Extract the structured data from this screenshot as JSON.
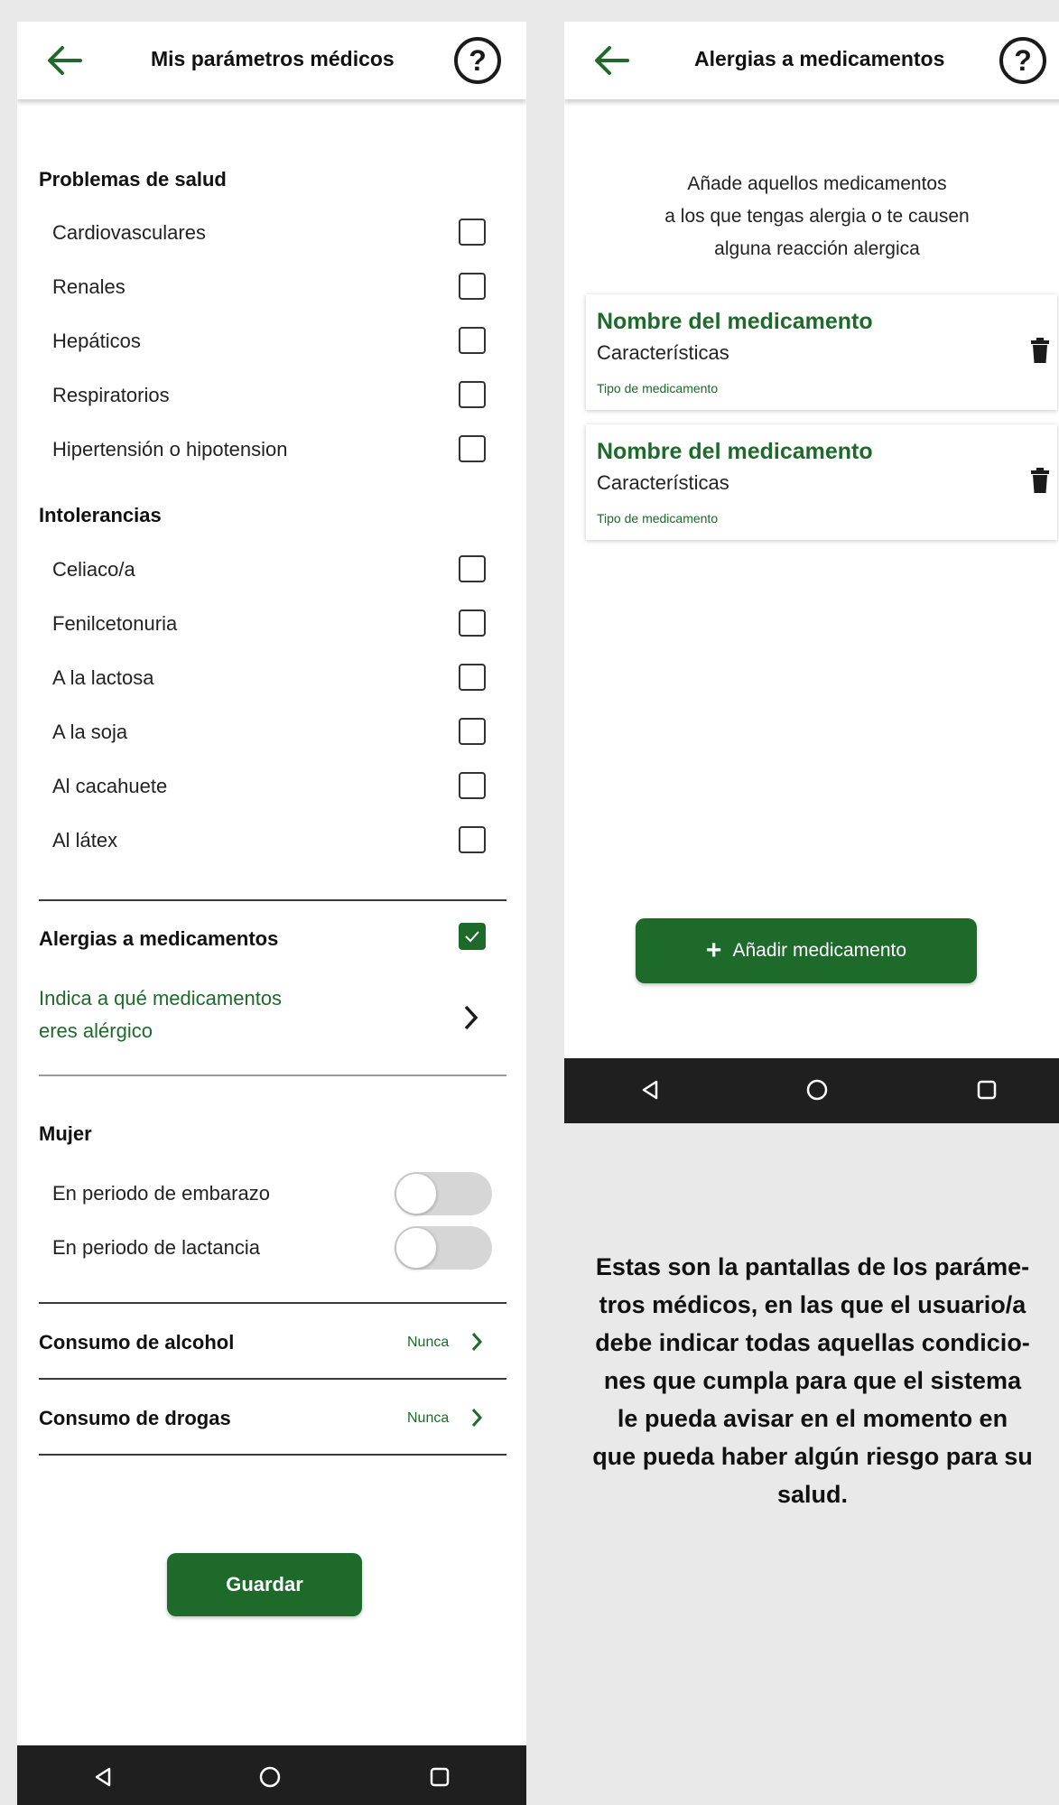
{
  "left_screen": {
    "title": "Mis parámetros médicos",
    "help_symbol": "?",
    "problems": {
      "heading": "Problemas de salud",
      "items": [
        "Cardiovasculares",
        "Renales",
        "Hepáticos",
        "Respiratorios",
        "Hipertensión o hipotension"
      ]
    },
    "intolerances": {
      "heading": "Intolerancias",
      "items": [
        "Celiaco/a",
        "Fenilcetonuria",
        "A la lactosa",
        "A la soja",
        "Al cacahuete",
        "Al látex"
      ]
    },
    "allergies": {
      "heading": "Alergias a medicamentos",
      "checked": true,
      "link_line1": "Indica a qué medicamentos",
      "link_line2": "eres alérgico"
    },
    "woman": {
      "heading": "Mujer",
      "pregnancy": {
        "label": "En periodo de embarazo",
        "on": false
      },
      "lactation": {
        "label": "En periodo de lactancia",
        "on": false
      }
    },
    "alcohol": {
      "label": "Consumo de alcohol",
      "value": "Nunca"
    },
    "drugs": {
      "label": "Consumo de drogas",
      "value": "Nunca"
    },
    "save_label": "Guardar"
  },
  "right_screen": {
    "title": "Alergias a medicamentos",
    "help_symbol": "?",
    "intro_lines": [
      "Añade aquellos medicamentos",
      "a los que tengas alergia o te causen",
      "alguna reacción alergica"
    ],
    "cards": [
      {
        "name": "Nombre del medicamento",
        "characteristics": "Características",
        "type": "Tipo de medicamento"
      },
      {
        "name": "Nombre del medicamento",
        "characteristics": "Características",
        "type": "Tipo de medicamento"
      }
    ],
    "add_button": {
      "icon": "+",
      "label": "Añadir medicamento"
    }
  },
  "caption_lines": [
    "Estas son la pantallas de los paráme-",
    "tros médicos, en las que el usuario/a",
    "debe indicar todas aquellas condicio-",
    "nes que cumpla para que el sistema",
    "le pueda avisar en el momento en",
    "que pueda haber algún riesgo para su",
    "salud."
  ],
  "colors": {
    "accent_green": "#1d6a2b",
    "navbar": "#1f1f1f",
    "background": "#e9e9e9"
  },
  "icons": [
    "back-arrow-icon",
    "help-icon",
    "chevron-right-icon",
    "trash-icon",
    "plus-icon",
    "nav-back-icon",
    "nav-home-icon",
    "nav-recents-icon"
  ]
}
